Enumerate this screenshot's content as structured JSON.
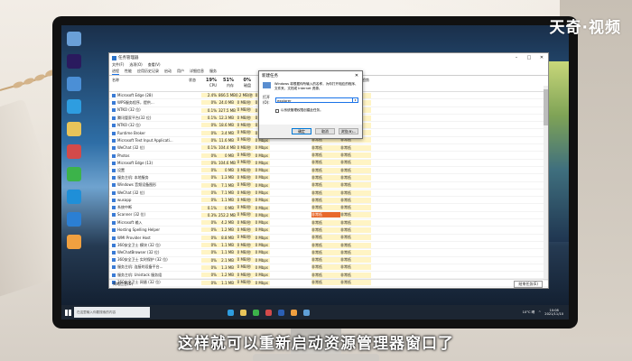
{
  "watermark": {
    "logo": "天奇·视频"
  },
  "subtitle": "这样就可以重新启动资源管理器窗口了",
  "colors": {
    "accent": "#1a73e8",
    "cpu_highlight": "#fff4c4",
    "hot_cell": "#e8692c",
    "taskbar": "#1c2633"
  },
  "task_manager": {
    "title": "任务管理器",
    "menu": [
      "文件(F)",
      "选项(O)",
      "查看(V)"
    ],
    "tabs": [
      "进程",
      "性能",
      "应用历史记录",
      "启动",
      "用户",
      "详细信息",
      "服务"
    ],
    "columns": {
      "name": "名称",
      "status": "状态",
      "cpu": {
        "pct": "19%",
        "label": "CPU"
      },
      "memory": {
        "pct": "51%",
        "label": "内存"
      },
      "disk": {
        "pct": "0%",
        "label": "磁盘"
      },
      "network": {
        "pct": "0%",
        "label": "网络"
      },
      "gpu": "GPU",
      "gpu_engine": "GPU 引擎",
      "power": "电源使用情况",
      "power_trend": "电源使用情况趋势"
    },
    "rows": [
      {
        "name": "Microsoft Edge (28)",
        "cpu": "2.4%",
        "mem": "866.5 MB",
        "disk": "0.2 MB/秒",
        "net": "0 Mbps",
        "power": "非常低",
        "trend": "非常低",
        "hot": false
      },
      {
        "name": "WPS服务程序，提供...",
        "cpu": "0%",
        "mem": "24.0 MB",
        "disk": "0 MB/秒",
        "net": "0 Mbps",
        "power": "非常低",
        "trend": "非常低",
        "hot": false
      },
      {
        "name": "NTKO (32 位)",
        "cpu": "0.1%",
        "mem": "327.5 MB",
        "disk": "0 MB/秒",
        "net": "0 Mbps",
        "power": "非常低",
        "trend": "非常低",
        "hot": false
      },
      {
        "name": "腾讯管家平台(32 位)",
        "cpu": "0.1%",
        "mem": "12.3 MB",
        "disk": "0 MB/秒",
        "net": "0 Mbps",
        "power": "非常低",
        "trend": "非常低",
        "hot": false
      },
      {
        "name": "NTKO (32 位)",
        "cpu": "0%",
        "mem": "18.6 MB",
        "disk": "0 MB/秒",
        "net": "0 Mbps",
        "power": "非常低",
        "trend": "非常低",
        "hot": false
      },
      {
        "name": "Runtime Broker",
        "cpu": "0%",
        "mem": "3.4 MB",
        "disk": "0 MB/秒",
        "net": "0 Mbps",
        "power": "非常低",
        "trend": "非常低",
        "hot": false
      },
      {
        "name": "Microsoft Text Input Applicati...",
        "cpu": "0%",
        "mem": "11.6 MB",
        "disk": "0 MB/秒",
        "net": "0 Mbps",
        "power": "非常低",
        "trend": "非常低",
        "hot": false
      },
      {
        "name": "WeChat (32 位)",
        "cpu": "0.1%",
        "mem": "104.4 MB",
        "disk": "0 MB/秒",
        "net": "0 Mbps",
        "power": "非常低",
        "trend": "非常低",
        "hot": false
      },
      {
        "name": "Photos",
        "cpu": "0%",
        "mem": "0 MB",
        "disk": "0 MB/秒",
        "net": "0 Mbps",
        "power": "非常低",
        "trend": "非常低",
        "hot": false
      },
      {
        "name": "Microsoft Edge (13)",
        "cpu": "0%",
        "mem": "104.6 MB",
        "disk": "0 MB/秒",
        "net": "0 Mbps",
        "power": "非常低",
        "trend": "非常低",
        "hot": false
      },
      {
        "name": "设置",
        "cpu": "0%",
        "mem": "0 MB",
        "disk": "0 MB/秒",
        "net": "0 Mbps",
        "power": "非常低",
        "trend": "非常低",
        "hot": false
      },
      {
        "name": "服务主机: 本地服务",
        "cpu": "0%",
        "mem": "1.3 MB",
        "disk": "0 MB/秒",
        "net": "0 Mbps",
        "power": "非常低",
        "trend": "非常低",
        "hot": false
      },
      {
        "name": "Windows 音频设备图形",
        "cpu": "0%",
        "mem": "7.1 MB",
        "disk": "0 MB/秒",
        "net": "0 Mbps",
        "power": "非常低",
        "trend": "非常低",
        "hot": false
      },
      {
        "name": "WeChat (32 位)",
        "cpu": "0%",
        "mem": "7.1 MB",
        "disk": "0 MB/秒",
        "net": "0 Mbps",
        "power": "非常低",
        "trend": "非常低",
        "hot": false
      },
      {
        "name": "wusapp",
        "cpu": "0%",
        "mem": "1.1 MB",
        "disk": "0 MB/秒",
        "net": "0 Mbps",
        "power": "非常低",
        "trend": "非常低",
        "hot": false
      },
      {
        "name": "系统中断",
        "cpu": "0.1%",
        "mem": "0 MB",
        "disk": "0 MB/秒",
        "net": "0 Mbps",
        "power": "非常低",
        "trend": "非常低",
        "hot": false
      },
      {
        "name": "Scanner (32 位)",
        "cpu": "0.3%",
        "mem": "252.2 MB",
        "disk": "0 MB/秒",
        "net": "0 Mbps",
        "power": "非常低",
        "trend": "非常低",
        "hot": true
      },
      {
        "name": "Microsoft 输入",
        "cpu": "0%",
        "mem": "4.2 MB",
        "disk": "0 MB/秒",
        "net": "0 Mbps",
        "power": "非常低",
        "trend": "非常低",
        "hot": false
      },
      {
        "name": "Hosting Spelling Helper",
        "cpu": "0%",
        "mem": "1.2 MB",
        "disk": "0 MB/秒",
        "net": "0 Mbps",
        "power": "非常低",
        "trend": "非常低",
        "hot": false
      },
      {
        "name": "WMI Provider Host",
        "cpu": "0%",
        "mem": "8.8 MB",
        "disk": "0 MB/秒",
        "net": "0 Mbps",
        "power": "非常低",
        "trend": "非常低",
        "hot": false
      },
      {
        "name": "360安全卫士 模块 (32 位)",
        "cpu": "0%",
        "mem": "1.1 MB",
        "disk": "0 MB/秒",
        "net": "0 Mbps",
        "power": "非常低",
        "trend": "非常低",
        "hot": false
      },
      {
        "name": "WeChatBrowser (32 位)",
        "cpu": "0%",
        "mem": "1.1 MB",
        "disk": "0 MB/秒",
        "net": "0 Mbps",
        "power": "非常低",
        "trend": "非常低",
        "hot": false
      },
      {
        "name": "360安全卫士 实时保护 (32 位)",
        "cpu": "0%",
        "mem": "2.1 MB",
        "disk": "0 MB/秒",
        "net": "0 Mbps",
        "power": "非常低",
        "trend": "非常低",
        "hot": false
      },
      {
        "name": "服务主机: 连接的设备平台...",
        "cpu": "0%",
        "mem": "1.3 MB",
        "disk": "0 MB/秒",
        "net": "0 Mbps",
        "power": "非常低",
        "trend": "非常低",
        "hot": false
      },
      {
        "name": "服务主机: Unistack 服务组",
        "cpu": "0%",
        "mem": "1.2 MB",
        "disk": "0 MB/秒",
        "net": "0 Mbps",
        "power": "非常低",
        "trend": "非常低",
        "hot": false
      },
      {
        "name": "360安全卫士 网盾 (32 位)",
        "cpu": "0%",
        "mem": "1.1 MB",
        "disk": "0 MB/秒",
        "net": "0 Mbps",
        "power": "非常低",
        "trend": "非常低",
        "hot": false
      }
    ],
    "footer_label": "简略信息(D)",
    "end_task": "结束任务(E)"
  },
  "new_task_dialog": {
    "title": "新建任务",
    "message": "Windows 将根据你所输入的名称，为你打开相应的程序、文件夹、文档或 Internet 资源。",
    "open_label": "打开(O):",
    "open_value": "explorer",
    "admin_checkbox": "以系统管理权限创建此任务。",
    "ok": "确定",
    "cancel": "取消",
    "browse": "浏览(B)..."
  },
  "taskbar": {
    "search_placeholder": "在这里输入你要搜索的内容",
    "weather": "10°C 晴",
    "time": "10:08",
    "date": "2021/11/10"
  },
  "desktop_icons": [
    "desktop-icon-1",
    "desktop-icon-2",
    "desktop-icon-3",
    "desktop-icon-4",
    "desktop-icon-5",
    "desktop-icon-6",
    "desktop-icon-7",
    "desktop-icon-8",
    "desktop-icon-9",
    "desktop-icon-10"
  ]
}
